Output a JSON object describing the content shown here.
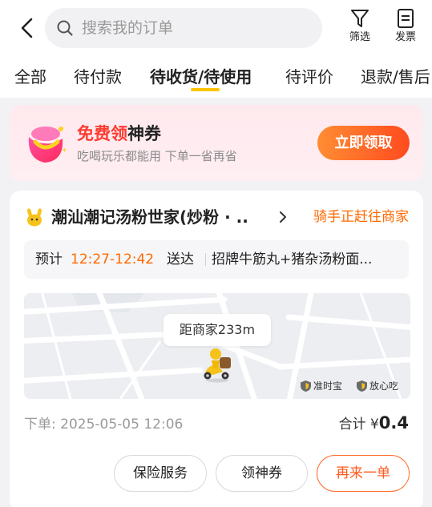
{
  "header": {
    "search_placeholder": "搜索我的订单",
    "filter_label": "筛选",
    "invoice_label": "发票"
  },
  "tabs": [
    {
      "label": "全部",
      "active": false
    },
    {
      "label": "待付款",
      "active": false
    },
    {
      "label": "待收货/待使用",
      "active": true
    },
    {
      "label": "待评价",
      "active": false
    },
    {
      "label": "退款/售后",
      "active": false
    }
  ],
  "promo": {
    "title_hot": "免费领",
    "title_rest": "神券",
    "subtitle": "吃喝玩乐都能用 下单一省再省",
    "button_label": "立即领取"
  },
  "order": {
    "shop_name": "潮汕潮记汤粉世家(炒粉 · ..",
    "status": "骑手正赶往商家",
    "eta_prefix": "预计",
    "eta_time": "12:27-12:42",
    "eta_suffix": "送达",
    "items": "招牌牛筋丸+猪杂汤粉面...",
    "distance": "距商家233m",
    "badge_1": "准时宝",
    "badge_2": "放心吃",
    "order_time": "下单: 2025-05-05 12:06",
    "total_label": "合计",
    "total_currency": "¥",
    "total_amount": "0.4",
    "buttons": {
      "insurance": "保险服务",
      "coupon": "领神券",
      "reorder": "再来一单"
    }
  },
  "colors": {
    "accent_orange": "#ff6a00",
    "promo_red": "#ff3b30",
    "tab_indicator": "#ffc400",
    "rider_yellow": "#f7c21a"
  },
  "icons": [
    "back-arrow-icon",
    "search-icon",
    "filter-icon",
    "invoice-icon",
    "coupon-bag-icon",
    "shop-logo-icon",
    "chevron-right-icon",
    "rider-icon",
    "shield-icon"
  ]
}
